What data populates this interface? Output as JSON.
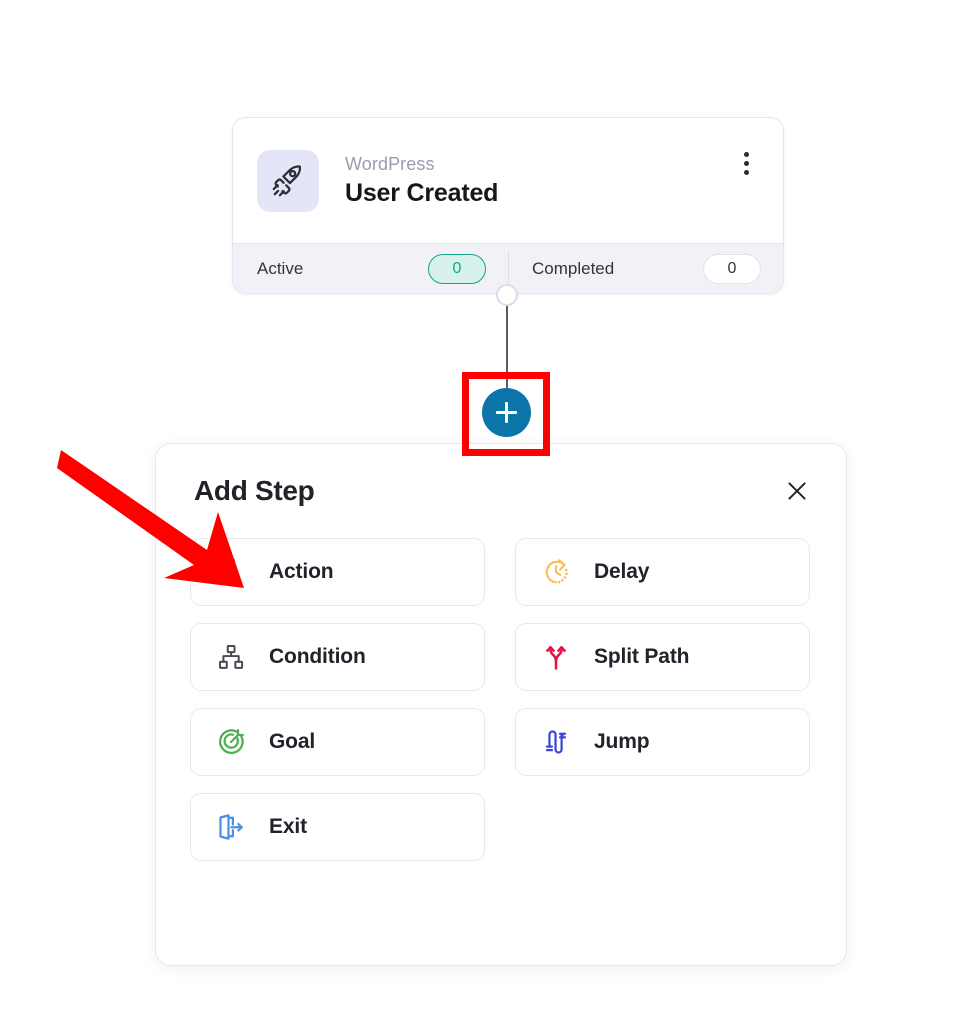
{
  "trigger_card": {
    "icon": "rocket-icon",
    "app_name": "WordPress",
    "trigger_name": "User Created",
    "menu_icon": "kebab-menu-icon",
    "stats": [
      {
        "label": "Active",
        "value": "0",
        "color": "#17a386"
      },
      {
        "label": "Completed",
        "value": "0",
        "color": "#33333d"
      }
    ]
  },
  "add_node_button": {
    "icon": "plus-icon",
    "color": "#0b74a8"
  },
  "annotations": {
    "highlight_rect_color": "#fe0000",
    "arrow_color": "#fe0000",
    "arrow_points_to": "Action"
  },
  "add_step_panel": {
    "title": "Add Step",
    "close_icon": "close-x-icon",
    "options": [
      {
        "label": "Action",
        "icon": "lightning-bolt-icon",
        "color": "#f0502e"
      },
      {
        "label": "Delay",
        "icon": "clock-icon",
        "color": "#fcbe53"
      },
      {
        "label": "Condition",
        "icon": "hierarchy-icon",
        "color": "#4a4a52"
      },
      {
        "label": "Split Path",
        "icon": "split-path-icon",
        "color": "#e8124b"
      },
      {
        "label": "Goal",
        "icon": "target-icon",
        "color": "#4caf50"
      },
      {
        "label": "Jump",
        "icon": "jump-rope-icon",
        "color": "#3b46d8"
      },
      {
        "label": "Exit",
        "icon": "exit-door-icon",
        "color": "#4a90e8"
      }
    ]
  }
}
